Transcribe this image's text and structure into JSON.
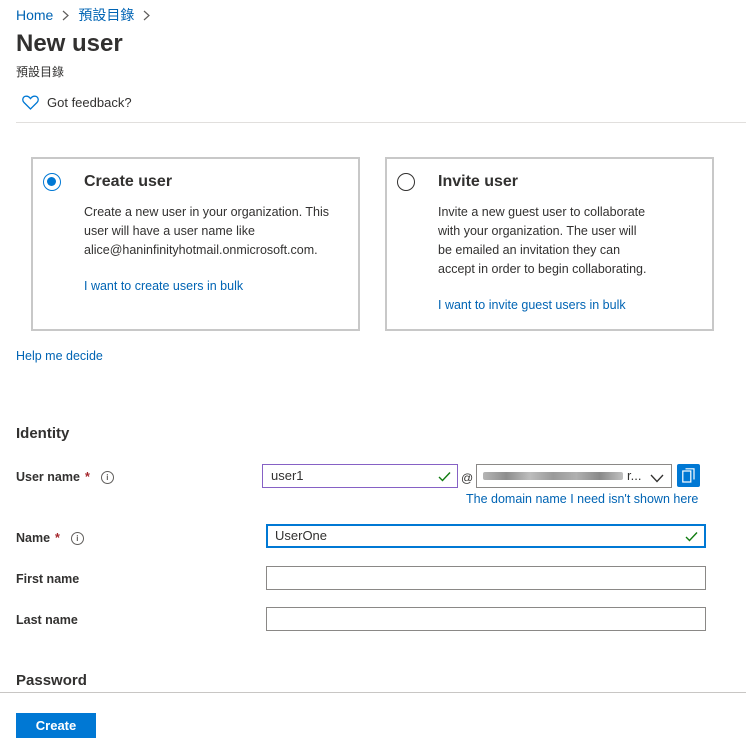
{
  "breadcrumb": {
    "home": "Home",
    "directory": "預設目錄"
  },
  "header": {
    "title": "New user",
    "subtitle": "預設目錄"
  },
  "feedback": {
    "label": "Got feedback?"
  },
  "options": [
    {
      "title": "Create user",
      "selected": true,
      "description": "Create a new user in your organization. This user will have a user name like alice@haninfinityhotmail.onmicrosoft.com.",
      "link": "I want to create users in bulk"
    },
    {
      "title": "Invite user",
      "selected": false,
      "description": "Invite a new guest user to collaborate with your organization. The user will be emailed an invitation they can accept in order to begin collaborating.",
      "link": "I want to invite guest users in bulk"
    }
  ],
  "help_link": "Help me decide",
  "identity": {
    "section_title": "Identity",
    "username": {
      "label": "User name",
      "value": "user1",
      "at": "@",
      "domain_suffix": "r...",
      "domain_link": "The domain name I need isn't shown here"
    },
    "name": {
      "label": "Name",
      "value": "UserOne"
    },
    "first_name": {
      "label": "First name",
      "value": ""
    },
    "last_name": {
      "label": "Last name",
      "value": ""
    }
  },
  "password": {
    "section_title": "Password"
  },
  "footer": {
    "create_label": "Create"
  },
  "colors": {
    "accent": "#0078d4",
    "link": "#0064b4",
    "required": "#a4262c",
    "valid_check": "#107c10"
  }
}
